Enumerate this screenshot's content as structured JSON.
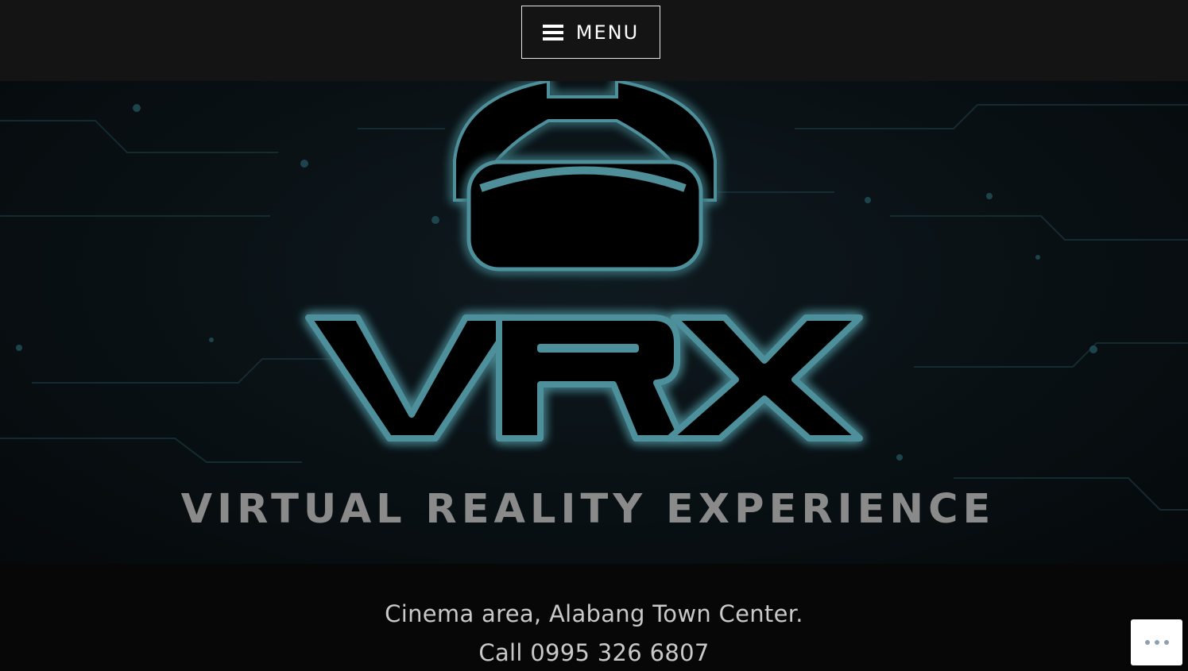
{
  "header": {
    "menu_label": "MENU",
    "menu_icon": "hamburger-icon"
  },
  "hero": {
    "brand": "VRX",
    "tagline": "VIRTUAL REALITY EXPERIENCE",
    "logo_icon": "vr-headset-icon",
    "colors": {
      "glow": "#5fc4d8",
      "outline": "#4f8e99",
      "tagline": "#8a8a8a"
    }
  },
  "info": {
    "address": "Cinema area, Alabang Town Center.",
    "phone": "Call 0995 326 6807"
  },
  "actions": {
    "more_icon": "ellipsis-icon"
  }
}
